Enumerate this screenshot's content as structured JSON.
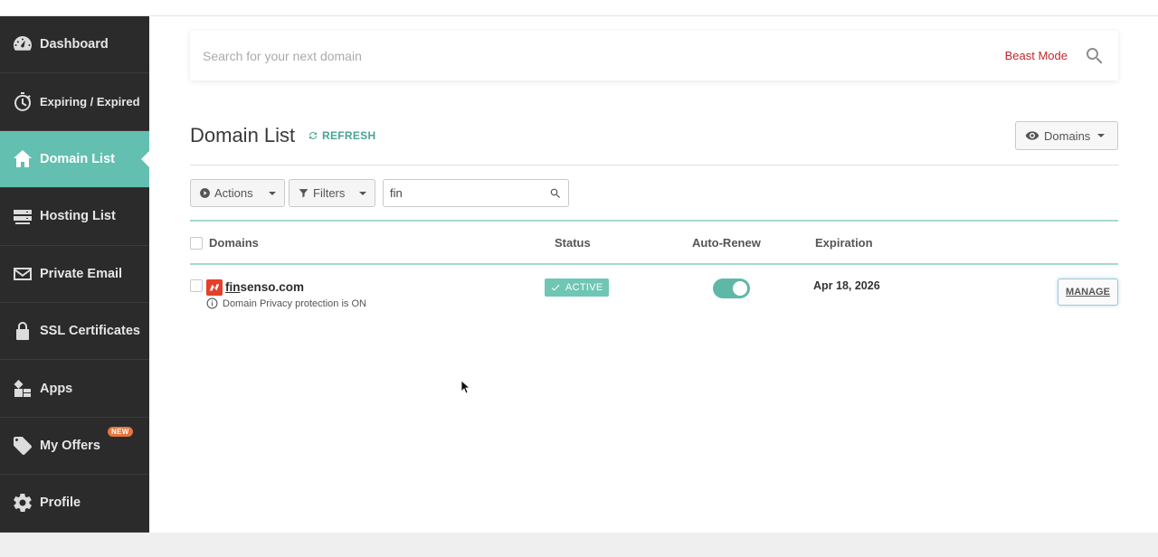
{
  "sidebar": {
    "items": [
      {
        "label": "Dashboard",
        "icon": "gauge-icon"
      },
      {
        "label": "Expiring / Expired",
        "icon": "stopwatch-icon"
      },
      {
        "label": "Domain List",
        "icon": "home-icon",
        "active": true
      },
      {
        "label": "Hosting List",
        "icon": "server-icon"
      },
      {
        "label": "Private Email",
        "icon": "envelope-icon"
      },
      {
        "label": "SSL Certificates",
        "icon": "lock-icon"
      },
      {
        "label": "Apps",
        "icon": "apps-icon"
      },
      {
        "label": "My Offers",
        "icon": "tag-icon",
        "badge": "NEW"
      },
      {
        "label": "Profile",
        "icon": "gear-icon"
      }
    ]
  },
  "search": {
    "placeholder": "Search for your next domain",
    "beast_mode": "Beast Mode"
  },
  "header": {
    "title": "Domain List",
    "refresh": "REFRESH",
    "view_select": "Domains"
  },
  "toolbar": {
    "actions": "Actions",
    "filters": "Filters",
    "filter_value": "fin"
  },
  "table": {
    "columns": {
      "domains": "Domains",
      "status": "Status",
      "auto_renew": "Auto-Renew",
      "expiration": "Expiration"
    },
    "rows": [
      {
        "domain_prefix": "fin",
        "domain_rest": "senso.com",
        "note": "Domain Privacy protection is ON",
        "status": "ACTIVE",
        "auto_renew": true,
        "expiration": "Apr 18, 2026",
        "action": "MANAGE"
      }
    ]
  },
  "colors": {
    "sidebar_bg": "#2b2b2b",
    "accent": "#63bfb0",
    "beast_mode": "#c0282d",
    "badge_new": "#e8743b",
    "domain_icon": "#e4402b"
  }
}
